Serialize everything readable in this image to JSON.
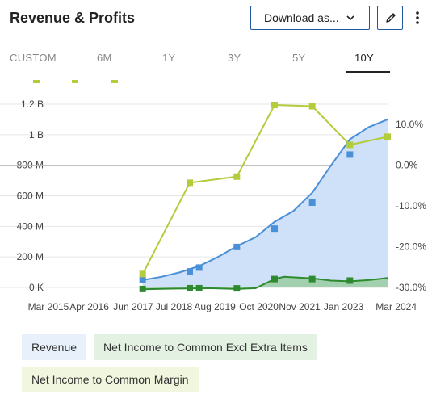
{
  "header": {
    "title": "Revenue & Profits",
    "download_label": "Download as..."
  },
  "icons": {
    "download_caret": "chevron-down-icon",
    "edit": "pencil-icon",
    "more": "more-vertical-icon"
  },
  "tabs": [
    {
      "label": "CUSTOM",
      "active": false
    },
    {
      "label": "6M",
      "active": false
    },
    {
      "label": "1Y",
      "active": false
    },
    {
      "label": "3Y",
      "active": false
    },
    {
      "label": "5Y",
      "active": false
    },
    {
      "label": "10Y",
      "active": true
    }
  ],
  "legend_chips": [
    {
      "label": "Revenue"
    },
    {
      "label": "Net Income to Common Excl Extra Items"
    },
    {
      "label": "Net Income to Common Margin"
    }
  ],
  "chart_data": {
    "type": "line",
    "x_ticks": [
      "Mar 2015",
      "Apr 2016",
      "Jun 2017",
      "Jul 2018",
      "Aug 2019",
      "Oct 2020",
      "Nov 2021",
      "Jan 2023",
      "Mar 2024"
    ],
    "y_left_ticks": [
      "0 K",
      "200 M",
      "400 M",
      "600 M",
      "800 M",
      "1 B",
      "1.2 B"
    ],
    "y_right_ticks": [
      "-30.0%",
      "-20.0%",
      "-10.0%",
      "0.0%",
      "10.0%"
    ],
    "ylim_left": [
      0,
      1200000000
    ],
    "ylim_right": [
      -30,
      15
    ],
    "grid": true,
    "series": [
      {
        "name": "Revenue",
        "axis": "left",
        "color": "#4a90d9",
        "fill": "#cfe1f8",
        "line": [
          [
            "2017-09",
            48000000
          ],
          [
            "2018-03",
            70000000
          ],
          [
            "2018-09",
            100000000
          ],
          [
            "2019-03",
            140000000
          ],
          [
            "2019-09",
            200000000
          ],
          [
            "2020-03",
            270000000
          ],
          [
            "2020-09",
            330000000
          ],
          [
            "2021-03",
            430000000
          ],
          [
            "2021-09",
            500000000
          ],
          [
            "2022-03",
            620000000
          ],
          [
            "2022-09",
            800000000
          ],
          [
            "2023-03",
            970000000
          ],
          [
            "2023-09",
            1050000000
          ],
          [
            "2024-03",
            1100000000
          ]
        ],
        "markers": [
          [
            "2017-09",
            48000000
          ],
          [
            "2018-12",
            105000000
          ],
          [
            "2019-03",
            130000000
          ],
          [
            "2020-03",
            265000000
          ],
          [
            "2021-03",
            385000000
          ],
          [
            "2022-03",
            555000000
          ],
          [
            "2023-03",
            870000000
          ]
        ]
      },
      {
        "name": "Net Income to Common Excl Extra Items",
        "axis": "left",
        "color": "#2e8a2e",
        "fill": "#8fc98f",
        "line": [
          [
            "2017-09",
            -12000000
          ],
          [
            "2018-06",
            -8000000
          ],
          [
            "2019-06",
            -5000000
          ],
          [
            "2020-03",
            -10000000
          ],
          [
            "2020-09",
            -5000000
          ],
          [
            "2021-03",
            55000000
          ],
          [
            "2021-06",
            70000000
          ],
          [
            "2022-03",
            60000000
          ],
          [
            "2022-09",
            45000000
          ],
          [
            "2023-03",
            40000000
          ],
          [
            "2023-09",
            48000000
          ],
          [
            "2024-03",
            62000000
          ]
        ],
        "markers": [
          [
            "2017-09",
            -10000000
          ],
          [
            "2018-12",
            -5000000
          ],
          [
            "2019-03",
            -5000000
          ],
          [
            "2020-03",
            -6000000
          ],
          [
            "2021-03",
            55000000
          ],
          [
            "2022-03",
            55000000
          ],
          [
            "2023-03",
            45000000
          ]
        ]
      },
      {
        "name": "Net Income to Common Margin",
        "axis": "right",
        "color": "#b2cc3c",
        "line": [
          [
            "2017-09",
            -26.7
          ],
          [
            "2018-12",
            -4.3
          ],
          [
            "2020-03",
            -2.8
          ],
          [
            "2021-03",
            14.8
          ],
          [
            "2022-03",
            14.5
          ],
          [
            "2023-03",
            5.0
          ],
          [
            "2024-03",
            7.0
          ]
        ],
        "markers": [
          [
            "2017-09",
            -26.7
          ],
          [
            "2018-12",
            -4.3
          ],
          [
            "2020-03",
            -2.8
          ],
          [
            "2021-03",
            14.8
          ],
          [
            "2022-03",
            14.5
          ],
          [
            "2023-03",
            5.0
          ],
          [
            "2024-03",
            7.0
          ]
        ]
      }
    ]
  }
}
